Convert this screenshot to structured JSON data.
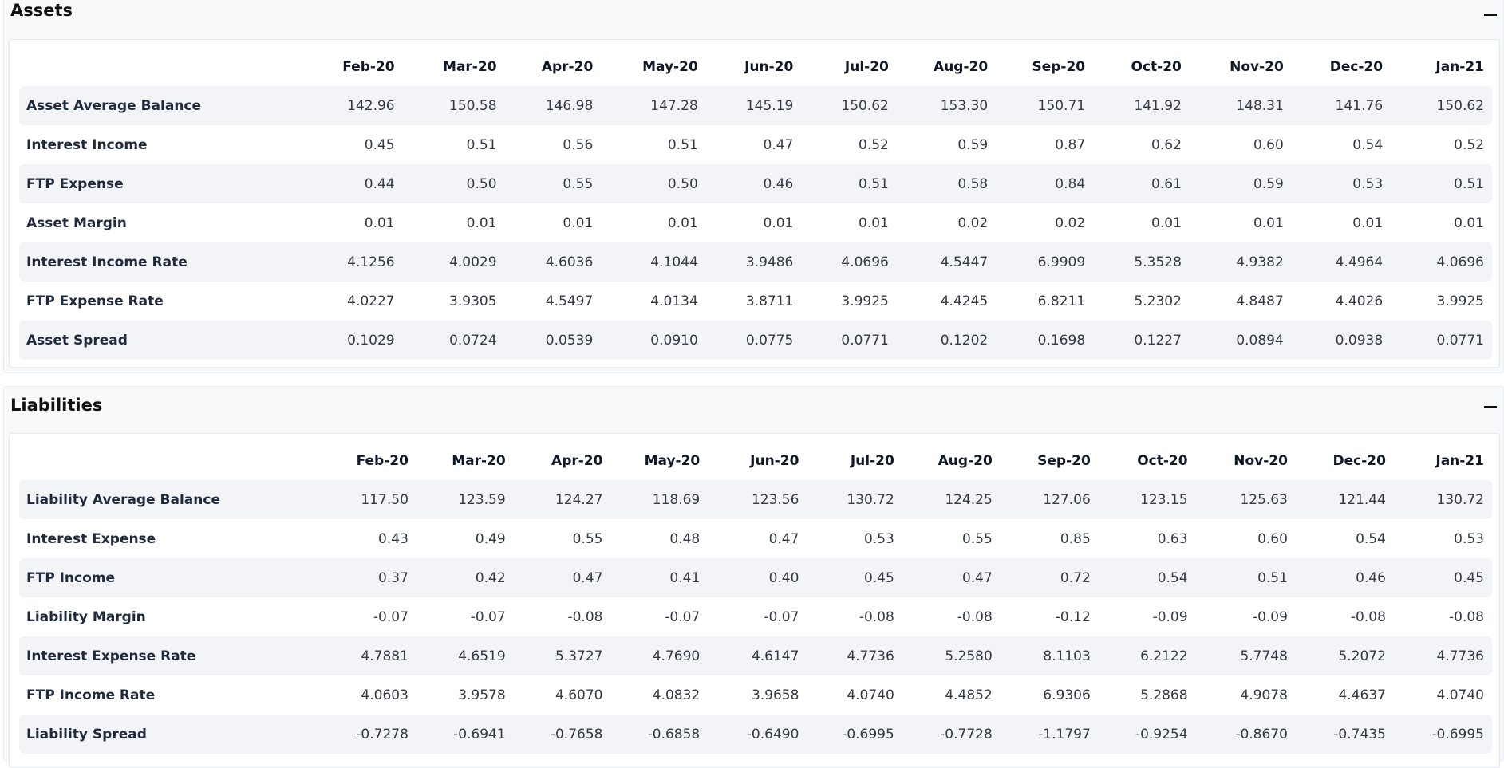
{
  "assets": {
    "title": "Assets",
    "columns": [
      "Feb-20",
      "Mar-20",
      "Apr-20",
      "May-20",
      "Jun-20",
      "Jul-20",
      "Aug-20",
      "Sep-20",
      "Oct-20",
      "Nov-20",
      "Dec-20",
      "Jan-21"
    ],
    "rows": [
      {
        "label": "Asset Average Balance",
        "values": [
          "142.96",
          "150.58",
          "146.98",
          "147.28",
          "145.19",
          "150.62",
          "153.30",
          "150.71",
          "141.92",
          "148.31",
          "141.76",
          "150.62"
        ]
      },
      {
        "label": "Interest Income",
        "values": [
          "0.45",
          "0.51",
          "0.56",
          "0.51",
          "0.47",
          "0.52",
          "0.59",
          "0.87",
          "0.62",
          "0.60",
          "0.54",
          "0.52"
        ]
      },
      {
        "label": "FTP Expense",
        "values": [
          "0.44",
          "0.50",
          "0.55",
          "0.50",
          "0.46",
          "0.51",
          "0.58",
          "0.84",
          "0.61",
          "0.59",
          "0.53",
          "0.51"
        ]
      },
      {
        "label": "Asset Margin",
        "values": [
          "0.01",
          "0.01",
          "0.01",
          "0.01",
          "0.01",
          "0.01",
          "0.02",
          "0.02",
          "0.01",
          "0.01",
          "0.01",
          "0.01"
        ]
      },
      {
        "label": "Interest Income Rate",
        "values": [
          "4.1256",
          "4.0029",
          "4.6036",
          "4.1044",
          "3.9486",
          "4.0696",
          "4.5447",
          "6.9909",
          "5.3528",
          "4.9382",
          "4.4964",
          "4.0696"
        ]
      },
      {
        "label": "FTP Expense Rate",
        "values": [
          "4.0227",
          "3.9305",
          "4.5497",
          "4.0134",
          "3.8711",
          "3.9925",
          "4.4245",
          "6.8211",
          "5.2302",
          "4.8487",
          "4.4026",
          "3.9925"
        ]
      },
      {
        "label": "Asset Spread",
        "values": [
          "0.1029",
          "0.0724",
          "0.0539",
          "0.0910",
          "0.0775",
          "0.0771",
          "0.1202",
          "0.1698",
          "0.1227",
          "0.0894",
          "0.0938",
          "0.0771"
        ]
      }
    ]
  },
  "liabilities": {
    "title": "Liabilities",
    "columns": [
      "Feb-20",
      "Mar-20",
      "Apr-20",
      "May-20",
      "Jun-20",
      "Jul-20",
      "Aug-20",
      "Sep-20",
      "Oct-20",
      "Nov-20",
      "Dec-20",
      "Jan-21"
    ],
    "rows": [
      {
        "label": "Liability Average Balance",
        "values": [
          "117.50",
          "123.59",
          "124.27",
          "118.69",
          "123.56",
          "130.72",
          "124.25",
          "127.06",
          "123.15",
          "125.63",
          "121.44",
          "130.72"
        ]
      },
      {
        "label": "Interest Expense",
        "values": [
          "0.43",
          "0.49",
          "0.55",
          "0.48",
          "0.47",
          "0.53",
          "0.55",
          "0.85",
          "0.63",
          "0.60",
          "0.54",
          "0.53"
        ]
      },
      {
        "label": "FTP Income",
        "values": [
          "0.37",
          "0.42",
          "0.47",
          "0.41",
          "0.40",
          "0.45",
          "0.47",
          "0.72",
          "0.54",
          "0.51",
          "0.46",
          "0.45"
        ]
      },
      {
        "label": "Liability Margin",
        "values": [
          "-0.07",
          "-0.07",
          "-0.08",
          "-0.07",
          "-0.07",
          "-0.08",
          "-0.08",
          "-0.12",
          "-0.09",
          "-0.09",
          "-0.08",
          "-0.08"
        ]
      },
      {
        "label": "Interest Expense Rate",
        "values": [
          "4.7881",
          "4.6519",
          "5.3727",
          "4.7690",
          "4.6147",
          "4.7736",
          "5.2580",
          "8.1103",
          "6.2122",
          "5.7748",
          "5.2072",
          "4.7736"
        ]
      },
      {
        "label": "FTP Income Rate",
        "values": [
          "4.0603",
          "3.9578",
          "4.6070",
          "4.0832",
          "3.9658",
          "4.0740",
          "4.4852",
          "6.9306",
          "5.2868",
          "4.9078",
          "4.4637",
          "4.0740"
        ]
      },
      {
        "label": "Liability Spread",
        "values": [
          "-0.7278",
          "-0.6941",
          "-0.7658",
          "-0.6858",
          "-0.6490",
          "-0.6995",
          "-0.7728",
          "-1.1797",
          "-0.9254",
          "-0.8670",
          "-0.7435",
          "-0.6995"
        ]
      }
    ]
  }
}
